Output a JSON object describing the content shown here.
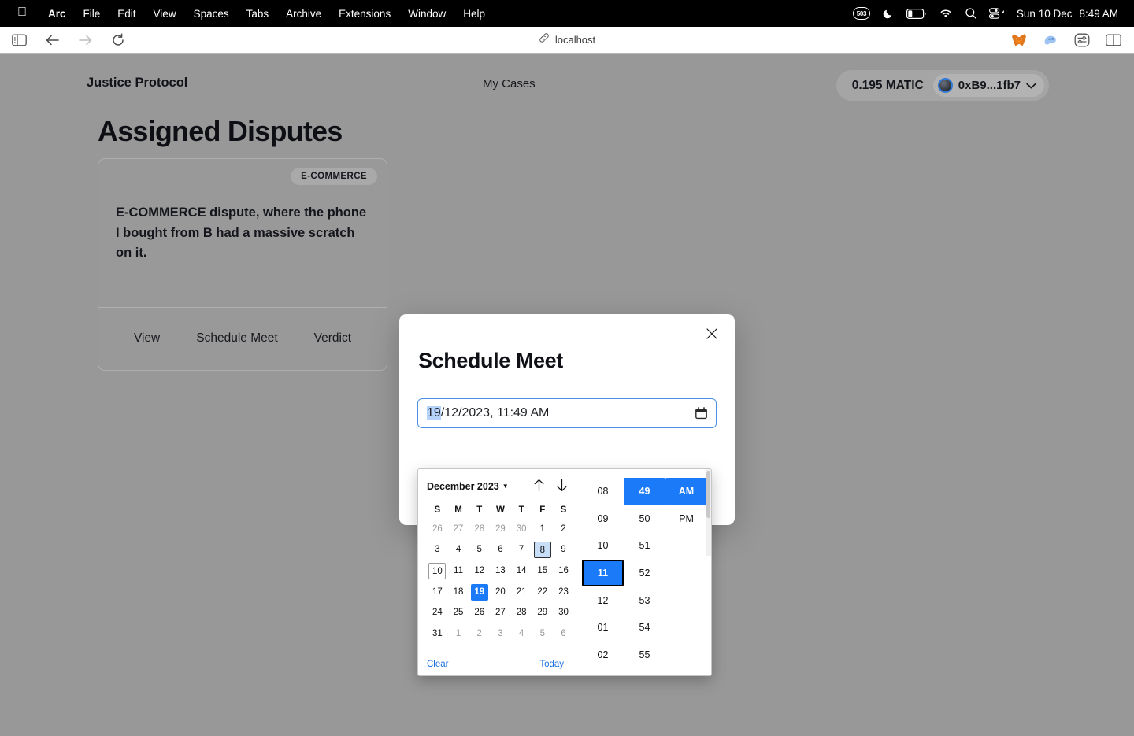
{
  "menubar": {
    "apple_icon": "apple-logo-icon",
    "items": [
      {
        "label": "Arc",
        "bold": true
      },
      {
        "label": "File",
        "bold": false
      },
      {
        "label": "Edit",
        "bold": false
      },
      {
        "label": "View",
        "bold": false
      },
      {
        "label": "Spaces",
        "bold": false
      },
      {
        "label": "Tabs",
        "bold": false
      },
      {
        "label": "Archive",
        "bold": false
      },
      {
        "label": "Extensions",
        "bold": false
      },
      {
        "label": "Window",
        "bold": false
      },
      {
        "label": "Help",
        "bold": false
      }
    ],
    "status": {
      "badge_count": "503",
      "icons": [
        "badge-503-icon",
        "moon-icon",
        "battery-icon",
        "wifi-icon",
        "search-icon",
        "control-center-icon"
      ],
      "date": "Sun 10 Dec",
      "time": "8:49 AM"
    }
  },
  "toolbar": {
    "left_icons": [
      "sidebar-toggle-icon",
      "back-arrow-icon",
      "forward-arrow-icon",
      "reload-icon"
    ],
    "url": "localhost",
    "url_icon": "link-icon",
    "right_icons": [
      "metamask-extension-icon",
      "ghost-extension-icon",
      "extensions-icon",
      "split-view-icon"
    ]
  },
  "app": {
    "brand": "Justice Protocol",
    "nav": {
      "my_cases": "My Cases"
    },
    "wallet": {
      "balance": "0.195 MATIC",
      "address": "0xB9...1fb7",
      "chevron": "chevron-down-icon"
    },
    "page_title": "Assigned Disputes",
    "card": {
      "tag": "E-COMMERCE",
      "description": "E-COMMERCE dispute, where the phone I bought from B had a massive scratch on it.",
      "actions": [
        "View",
        "Schedule Meet",
        "Verdict"
      ]
    }
  },
  "modal": {
    "title": "Schedule Meet",
    "close_icon": "close-icon",
    "datetime_input": {
      "selected_part": "19",
      "rest": "/12/2023, 11:49 AM",
      "full_value": "19/12/2023, 11:49 AM",
      "calendar_icon": "calendar-icon"
    }
  },
  "picker": {
    "month_label": "December 2023",
    "month_chevron": "chevron-down-icon",
    "arrow_up": "arrow-up-icon",
    "arrow_down": "arrow-down-icon",
    "dow": [
      "S",
      "M",
      "T",
      "W",
      "T",
      "F",
      "S"
    ],
    "weeks": [
      [
        {
          "d": "26",
          "s": "muted"
        },
        {
          "d": "27",
          "s": "muted"
        },
        {
          "d": "28",
          "s": "muted"
        },
        {
          "d": "29",
          "s": "muted"
        },
        {
          "d": "30",
          "s": "muted"
        },
        {
          "d": "1",
          "s": ""
        },
        {
          "d": "2",
          "s": ""
        }
      ],
      [
        {
          "d": "3",
          "s": ""
        },
        {
          "d": "4",
          "s": ""
        },
        {
          "d": "5",
          "s": ""
        },
        {
          "d": "6",
          "s": ""
        },
        {
          "d": "7",
          "s": ""
        },
        {
          "d": "8",
          "s": "hover"
        },
        {
          "d": "9",
          "s": ""
        }
      ],
      [
        {
          "d": "10",
          "s": "today"
        },
        {
          "d": "11",
          "s": ""
        },
        {
          "d": "12",
          "s": ""
        },
        {
          "d": "13",
          "s": ""
        },
        {
          "d": "14",
          "s": ""
        },
        {
          "d": "15",
          "s": ""
        },
        {
          "d": "16",
          "s": ""
        }
      ],
      [
        {
          "d": "17",
          "s": ""
        },
        {
          "d": "18",
          "s": ""
        },
        {
          "d": "19",
          "s": "selected"
        },
        {
          "d": "20",
          "s": ""
        },
        {
          "d": "21",
          "s": ""
        },
        {
          "d": "22",
          "s": ""
        },
        {
          "d": "23",
          "s": ""
        }
      ],
      [
        {
          "d": "24",
          "s": ""
        },
        {
          "d": "25",
          "s": ""
        },
        {
          "d": "26",
          "s": ""
        },
        {
          "d": "27",
          "s": ""
        },
        {
          "d": "28",
          "s": ""
        },
        {
          "d": "29",
          "s": ""
        },
        {
          "d": "30",
          "s": ""
        }
      ],
      [
        {
          "d": "31",
          "s": ""
        },
        {
          "d": "1",
          "s": "muted"
        },
        {
          "d": "2",
          "s": "muted"
        },
        {
          "d": "3",
          "s": "muted"
        },
        {
          "d": "4",
          "s": "muted"
        },
        {
          "d": "5",
          "s": "muted"
        },
        {
          "d": "6",
          "s": "muted"
        }
      ]
    ],
    "clear_label": "Clear",
    "today_label": "Today",
    "hours": [
      {
        "v": "08",
        "s": ""
      },
      {
        "v": "09",
        "s": ""
      },
      {
        "v": "10",
        "s": ""
      },
      {
        "v": "11",
        "s": "focusring"
      },
      {
        "v": "12",
        "s": ""
      },
      {
        "v": "01",
        "s": ""
      },
      {
        "v": "02",
        "s": ""
      }
    ],
    "minutes": [
      {
        "v": "49",
        "s": "selected"
      },
      {
        "v": "50",
        "s": ""
      },
      {
        "v": "51",
        "s": ""
      },
      {
        "v": "52",
        "s": ""
      },
      {
        "v": "53",
        "s": ""
      },
      {
        "v": "54",
        "s": ""
      },
      {
        "v": "55",
        "s": ""
      }
    ],
    "meridiem": [
      {
        "v": "AM",
        "s": "selected"
      },
      {
        "v": "PM",
        "s": ""
      }
    ]
  },
  "colors": {
    "accent_blue": "#1a7af8",
    "link_blue": "#1a6fe0",
    "input_focus": "#4a90e2",
    "selection_bg": "#b6d4fb",
    "backdrop": "rgba(60,60,60,0.53)"
  }
}
